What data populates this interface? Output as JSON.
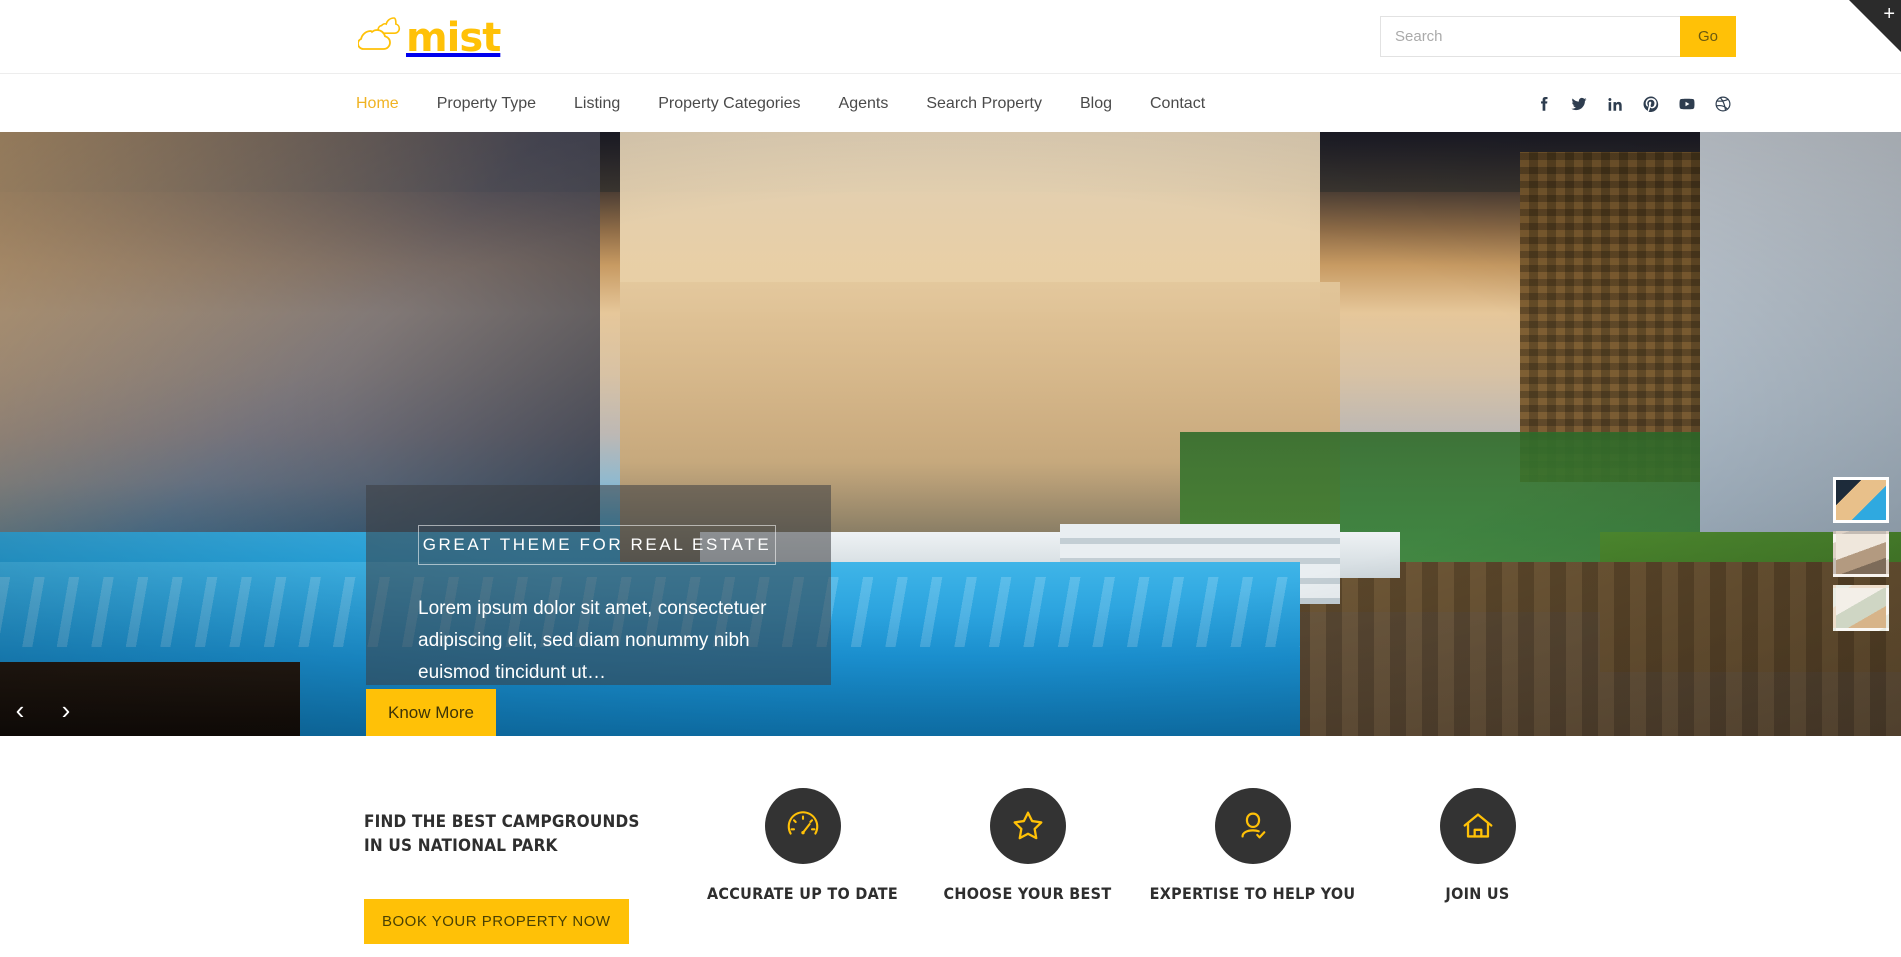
{
  "brand": {
    "name": "mist",
    "accent_color": "#FFC107",
    "icon": "cloud-icon"
  },
  "search": {
    "placeholder": "Search",
    "value": "",
    "button_label": "Go"
  },
  "corner": {
    "icon": "plus-icon",
    "label": "+"
  },
  "nav": {
    "items": [
      {
        "label": "Home",
        "active": true
      },
      {
        "label": "Property Type",
        "active": false
      },
      {
        "label": "Listing",
        "active": false
      },
      {
        "label": "Property Categories",
        "active": false
      },
      {
        "label": "Agents",
        "active": false
      },
      {
        "label": "Search Property",
        "active": false
      },
      {
        "label": "Blog",
        "active": false
      },
      {
        "label": "Contact",
        "active": false
      }
    ]
  },
  "social": [
    {
      "name": "facebook-icon",
      "label": "Facebook"
    },
    {
      "name": "twitter-icon",
      "label": "Twitter"
    },
    {
      "name": "linkedin-icon",
      "label": "LinkedIn"
    },
    {
      "name": "pinterest-icon",
      "label": "Pinterest"
    },
    {
      "name": "youtube-icon",
      "label": "YouTube"
    },
    {
      "name": "dribbble-icon",
      "label": "Dribbble"
    }
  ],
  "hero": {
    "caption_title": "GREAT THEME FOR REAL ESTATE",
    "caption_body": "Lorem ipsum dolor sit amet, consectetuer adipiscing elit, sed diam nonummy nibh euismod tincidunt ut…",
    "cta_label": "Know More",
    "prev_label": "‹",
    "next_label": "›",
    "thumbnails": [
      {
        "name": "hero-thumb-1",
        "active": true
      },
      {
        "name": "hero-thumb-2",
        "active": false
      },
      {
        "name": "hero-thumb-3",
        "active": false
      }
    ]
  },
  "promo": {
    "title": "FIND THE BEST CAMPGROUNDS IN US NATIONAL PARK",
    "button_label": "BOOK YOUR PROPERTY NOW"
  },
  "features": [
    {
      "icon": "speedometer-icon",
      "label": "ACCURATE UP TO DATE"
    },
    {
      "icon": "star-icon",
      "label": "CHOOSE YOUR BEST"
    },
    {
      "icon": "user-check-icon",
      "label": "EXPERTISE TO HELP YOU"
    },
    {
      "icon": "home-icon",
      "label": "JOIN US"
    }
  ],
  "colors": {
    "accent": "#FFC107",
    "nav_active": "#F0B323",
    "dark_circle": "#333333",
    "text": "#2e2e2e"
  }
}
